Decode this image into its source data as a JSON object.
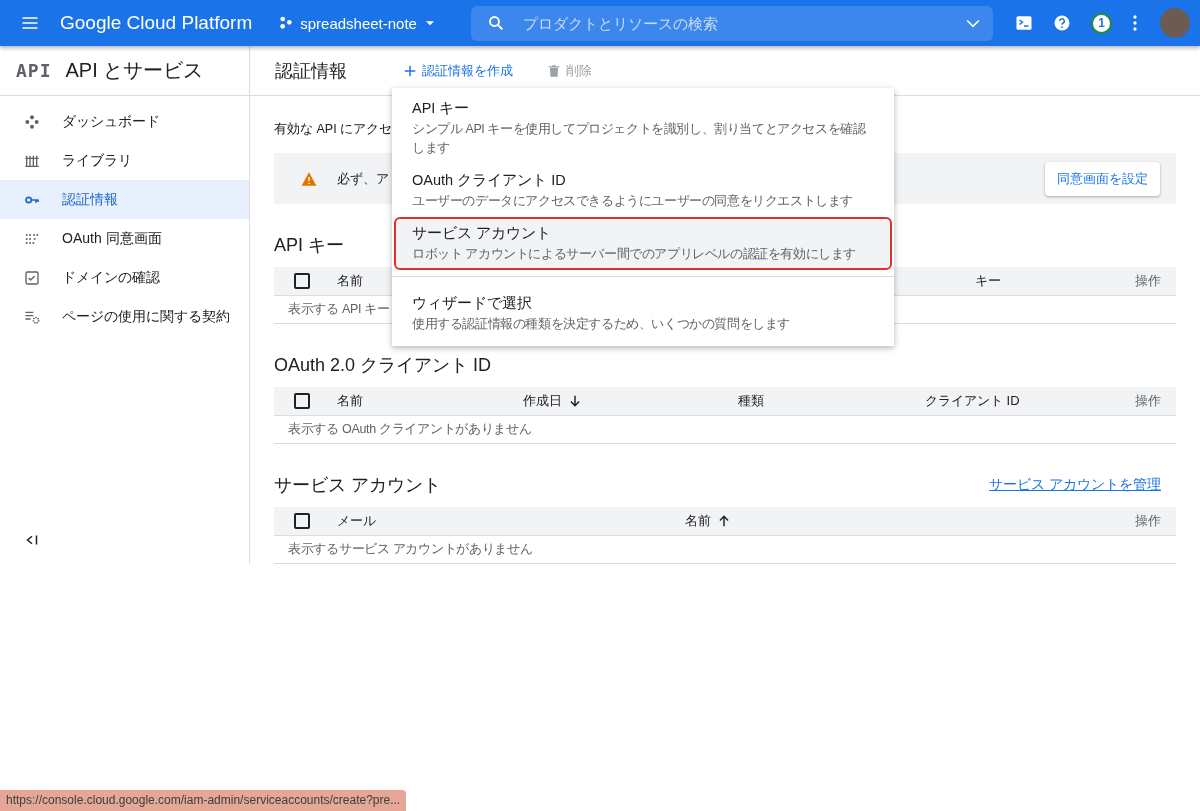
{
  "topbar": {
    "title": "Google Cloud Platform",
    "project": "spreadsheet-note",
    "search": {
      "placeholder": "プロダクトとリソースの検索"
    },
    "notification_count": "1"
  },
  "sidebar": {
    "logo": "API",
    "title": "API とサービス",
    "items": [
      {
        "label": "ダッシュボード",
        "selected": false
      },
      {
        "label": "ライブラリ",
        "selected": false
      },
      {
        "label": "認証情報",
        "selected": true
      },
      {
        "label": "OAuth 同意画面",
        "selected": false
      },
      {
        "label": "ドメインの確認",
        "selected": false
      },
      {
        "label": "ページの使用に関する契約",
        "selected": false
      }
    ]
  },
  "page": {
    "title": "認証情報",
    "actions": [
      {
        "label": "認証情報を作成",
        "disabled": false
      },
      {
        "label": "削除",
        "disabled": true
      }
    ],
    "description": "有効な API にアクセ",
    "banner": {
      "text": "必ず、ア",
      "button": "同意画面を設定"
    },
    "sections": [
      {
        "title": "API キー",
        "select_all_checked": false,
        "columns": [
          {
            "label": "名前"
          },
          {
            "label": "キー"
          },
          {
            "label": "操作"
          }
        ],
        "empty_text": "表示する API キー"
      },
      {
        "title": "OAuth 2.0 クライアント ID",
        "select_all_checked": false,
        "columns": [
          {
            "label": "名前"
          },
          {
            "label": "作成日",
            "sort_descending": true
          },
          {
            "label": "種類"
          },
          {
            "label": "クライアント ID"
          },
          {
            "label": "操作"
          }
        ],
        "empty_text": "表示する OAuth クライアントがありません"
      },
      {
        "title": "サービス アカウント",
        "link": "サービス アカウントを管理",
        "select_all_checked": false,
        "columns": [
          {
            "label": "メール"
          },
          {
            "label": "名前",
            "sort_descending": false
          },
          {
            "label": "操作"
          }
        ],
        "empty_text": "表示するサービス アカウントがありません"
      }
    ]
  },
  "create_menu": {
    "items": [
      {
        "title": "API キー",
        "description": "シンプル API キーを使用してプロジェクトを識別し、割り当てとアクセスを確認します",
        "highlighted": false
      },
      {
        "title": "OAuth クライアント ID",
        "description": "ユーザーのデータにアクセスできるようにユーザーの同意をリクエストします",
        "highlighted": false
      },
      {
        "title": "サービス アカウント",
        "description": "ロボット アカウントによるサーバー間でのアプリレベルの認証を有効にします",
        "highlighted": true
      },
      {
        "title": "ウィザードで選択",
        "description": "使用する認証情報の種類を決定するため、いくつかの質問をします",
        "highlighted": false
      }
    ]
  },
  "status_url": "https://console.cloud.google.com/iam-admin/serviceaccounts/create?pre..."
}
